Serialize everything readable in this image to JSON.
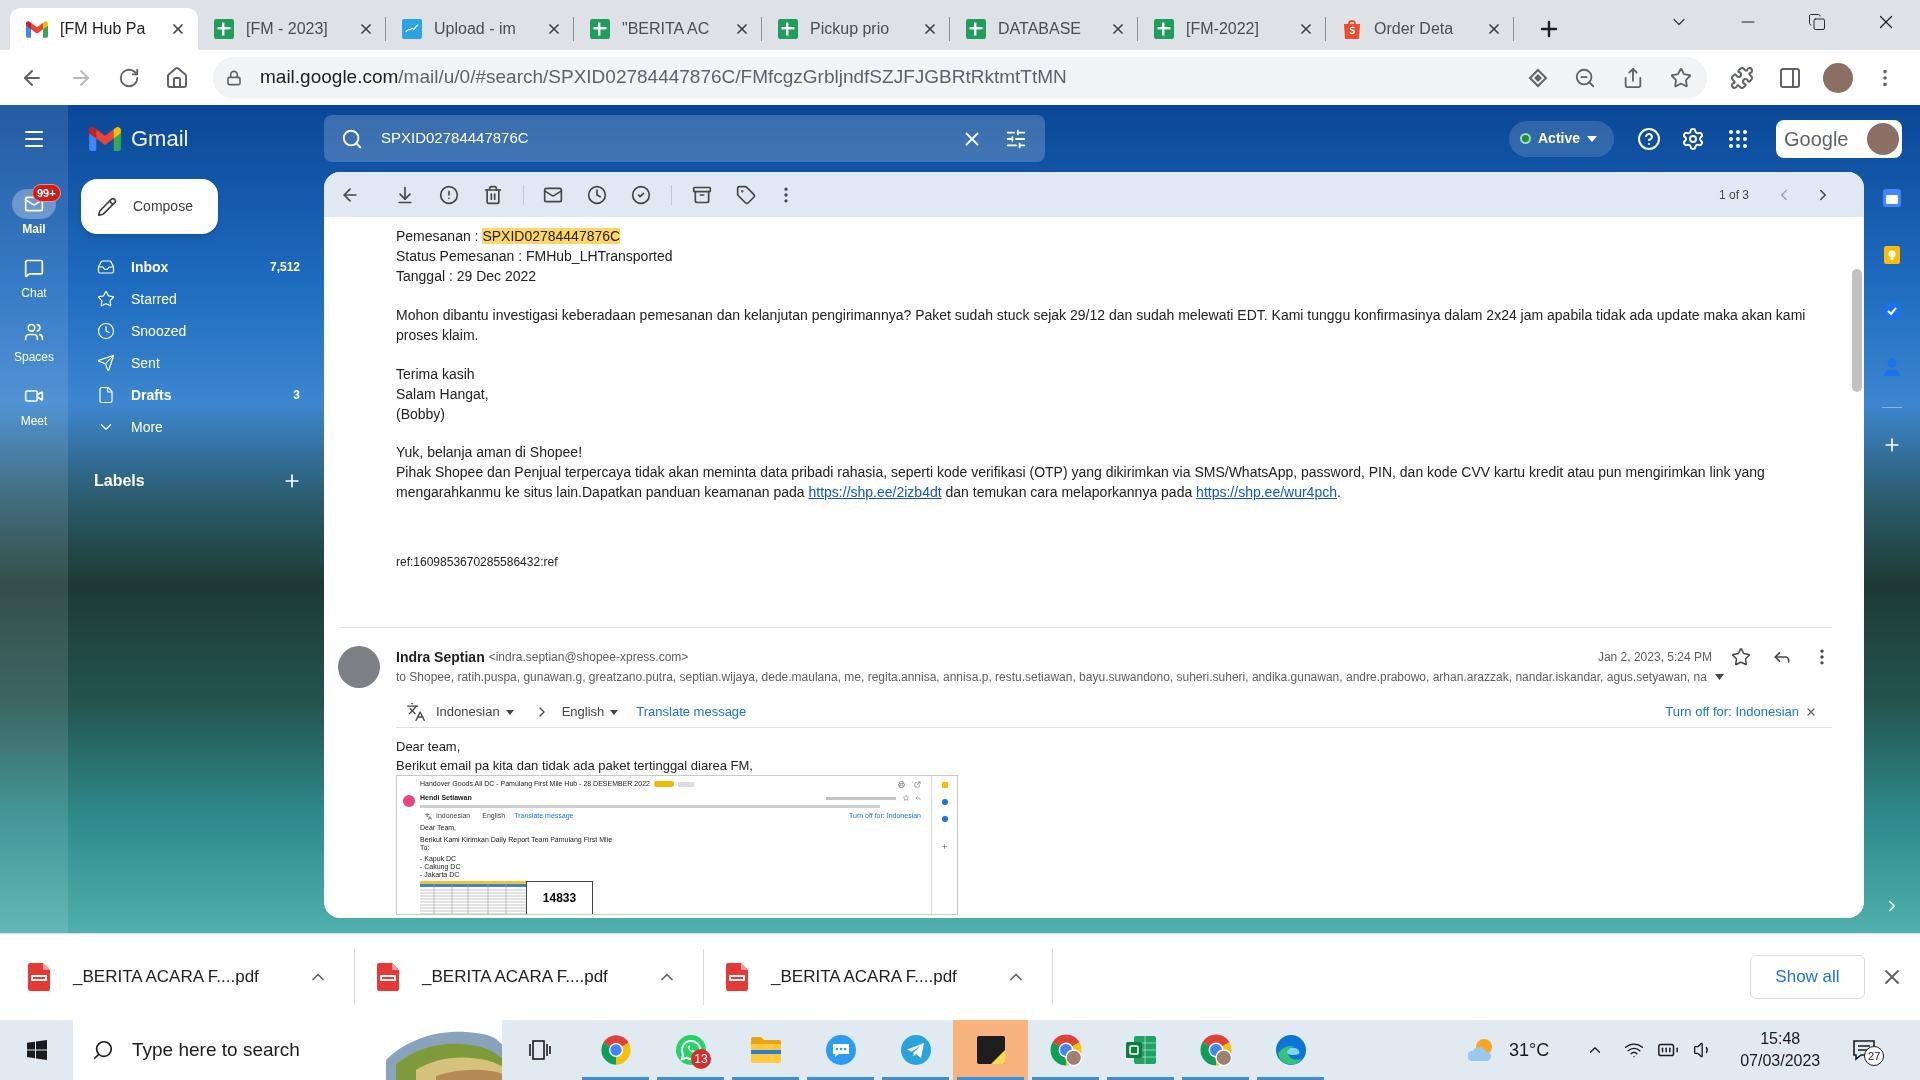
{
  "browser": {
    "tabs": [
      {
        "kind": "gmail",
        "title": "[FM Hub Pa",
        "selected": true
      },
      {
        "kind": "sheets",
        "title": "[FM - 2023]",
        "selected": false
      },
      {
        "kind": "upload",
        "title": "Upload - im",
        "selected": false
      },
      {
        "kind": "sheets",
        "title": "\"BERITA AC",
        "selected": false
      },
      {
        "kind": "sheets",
        "title": "Pickup prio",
        "selected": false
      },
      {
        "kind": "sheets",
        "title": "DATABASE",
        "selected": false
      },
      {
        "kind": "sheets",
        "title": "[FM-2022]",
        "selected": false
      },
      {
        "kind": "shop",
        "title": "Order Deta",
        "selected": false
      }
    ],
    "address": {
      "host": "mail.google.com",
      "path": "/mail/u/0/#search/SPXID02784447876C/FMfcgzGrbljndfSZJFJGBRtRktmtTtMN"
    }
  },
  "gmail": {
    "rail": [
      {
        "label": "Mail",
        "selected": true,
        "badge": "99+"
      },
      {
        "label": "Chat",
        "selected": false
      },
      {
        "label": "Spaces",
        "selected": false
      },
      {
        "label": "Meet",
        "selected": false
      }
    ],
    "logo": "Gmail",
    "search": {
      "value": "SPXID02784447876C"
    },
    "status": "Active",
    "account_label": "Google",
    "compose": "Compose",
    "folders": [
      {
        "label": "Inbox",
        "count": "7,512",
        "unread": true
      },
      {
        "label": "Starred",
        "unread": false
      },
      {
        "label": "Snoozed",
        "unread": false
      },
      {
        "label": "Sent",
        "unread": false
      },
      {
        "label": "Drafts",
        "count": "3",
        "unread": true
      },
      {
        "label": "More",
        "unread": false
      }
    ],
    "labels_heading": "Labels",
    "pager": "1 of 3",
    "message_1": {
      "order": {
        "label": "Pemesanan :",
        "id": "SPXID02784447876C"
      },
      "details": [
        "Status Pemesanan : FMHub_LHTransported",
        "Tanggal : 29 Dec 2022"
      ],
      "request": "Mohon dibantu investigasi keberadaan pemesanan dan kelanjutan pengirimannya? Paket sudah stuck sejak 29/12 dan sudah melewati EDT. Kami tunggu konfirmasinya dalam 2x24 jam apabila tidak ada update maka akan kami proses klaim.",
      "closing": [
        "Terima kasih",
        "Salam Hangat,",
        "(Bobby)"
      ],
      "notice_title": "Yuk, belanja aman di Shopee!",
      "notice": {
        "text": "Pihak Shopee dan Penjual terpercaya tidak akan meminta data pribadi rahasia, seperti kode verifikasi (OTP) yang dikirimkan via SMS/WhatsApp, password, PIN, dan kode CVV kartu kredit atau pun mengirimkan link yang mengarahkanmu ke situs lain.Dapatkan panduan keamanan pada",
        "link_1": "https://shp.ee/2izb4dt",
        "middle": "dan temukan cara melaporkannya pada",
        "link_2": "https://shp.ee/wur4pch",
        "end": "."
      },
      "ref": "ref:1609853670285586432:ref"
    },
    "message_2": {
      "sender": "Indra Septian",
      "email": "<indra.septian@shopee-xpress.com>",
      "date": "Jan 2, 2023, 5:24 PM",
      "starred": false,
      "recipients": "to Shopee, ratih.puspa, gunawan.g, greatzano.putra, septian.wijaya, dede.maulana, me, regita.annisa, annisa.p, restu.setiawan, bayu.suwandono, suheri.suheri, andika.gunawan, andre.prabowo, arhan.arazzak, nandar.iskandar, agus.setyawan, na",
      "translate": {
        "from": "Indonesian",
        "to": "English",
        "action": "Translate message",
        "turn_off": "Turn off for: Indonesian"
      },
      "body": [
        "Dear team,",
        "Berikut email pa kita dan tidak ada paket tertinggal diarea FM,"
      ],
      "screenshot": {
        "title": "Handover Goods All DC - Pamulang First Mile Hub - 28 DESEMBER 2022",
        "sender": "Hendi Setiawan",
        "translate": {
          "from": "Indonesian",
          "to": "English",
          "action": "Translate message",
          "turn_off": "Turn off for: Indonesian"
        },
        "greeting": "Dear Team,",
        "intro": [
          "Berikut Kami Kirimkan Daily Report Team Pamulang First Mile",
          "To:"
        ],
        "list": [
          "- Kapuk DC",
          "- Cakung DC",
          "- Jakarta DC"
        ],
        "total": "14833"
      }
    }
  },
  "downloads": {
    "items": [
      {
        "name": "_BERITA ACARA F....pdf"
      },
      {
        "name": "_BERITA ACARA F....pdf"
      },
      {
        "name": "_BERITA ACARA F....pdf"
      }
    ],
    "show_all": "Show all"
  },
  "taskbar": {
    "search_placeholder": "Type here to search",
    "apps": [
      {
        "kind": "task-view",
        "running": false,
        "flashing": false
      },
      {
        "kind": "browser",
        "running": true,
        "flashing": false
      },
      {
        "kind": "phone-chat",
        "running": true,
        "flashing": false,
        "badge": "13"
      },
      {
        "kind": "folder",
        "running": true,
        "flashing": false
      },
      {
        "kind": "chat",
        "running": true,
        "flashing": false
      },
      {
        "kind": "paper-plane",
        "running": true,
        "flashing": false
      },
      {
        "kind": "sticky-note",
        "running": true,
        "flashing": true
      },
      {
        "kind": "browser-profile",
        "running": true,
        "flashing": false
      },
      {
        "kind": "spreadsheet",
        "running": true,
        "flashing": false
      },
      {
        "kind": "browser-profile",
        "running": true,
        "flashing": false
      },
      {
        "kind": "swirl-browser",
        "running": true,
        "flashing": false
      }
    ],
    "tray": {
      "temperature": "31°C",
      "time": "15:48",
      "date": "07/03/2023",
      "notifications": "27"
    }
  }
}
